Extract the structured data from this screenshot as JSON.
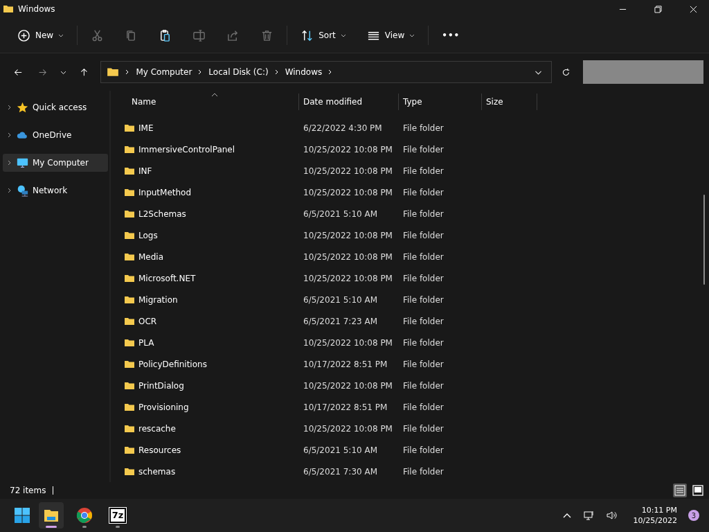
{
  "window": {
    "title": "Windows"
  },
  "toolbar": [
    {
      "kind": "new",
      "label": "New",
      "disabled": false
    },
    {
      "kind": "cut",
      "disabled": true
    },
    {
      "kind": "copy",
      "disabled": true
    },
    {
      "kind": "paste",
      "disabled": false
    },
    {
      "kind": "rename",
      "disabled": true
    },
    {
      "kind": "share",
      "disabled": true
    },
    {
      "kind": "delete",
      "disabled": true
    },
    {
      "kind": "sort",
      "label": "Sort",
      "disabled": false
    },
    {
      "kind": "view",
      "label": "View",
      "disabled": false
    },
    {
      "kind": "more",
      "label": "•••",
      "disabled": false
    }
  ],
  "nav": {
    "forward_disabled": true
  },
  "breadcrumb": [
    "My Computer",
    "Local Disk (C:)",
    "Windows"
  ],
  "sidebar": {
    "items": [
      {
        "label": "Quick access",
        "kind": "star",
        "selected": false
      },
      {
        "label": "OneDrive",
        "kind": "cloud",
        "selected": false
      },
      {
        "label": "My Computer",
        "kind": "pc",
        "selected": true
      },
      {
        "label": "Network",
        "kind": "network",
        "selected": false
      }
    ]
  },
  "table": {
    "columns": [
      "Name",
      "Date modified",
      "Type",
      "Size"
    ],
    "rows": [
      [
        "IME",
        "6/22/2022 4:30 PM",
        "File folder"
      ],
      [
        "ImmersiveControlPanel",
        "10/25/2022 10:08 PM",
        "File folder"
      ],
      [
        "INF",
        "10/25/2022 10:08 PM",
        "File folder"
      ],
      [
        "InputMethod",
        "10/25/2022 10:08 PM",
        "File folder"
      ],
      [
        "L2Schemas",
        "6/5/2021 5:10 AM",
        "File folder"
      ],
      [
        "Logs",
        "10/25/2022 10:08 PM",
        "File folder"
      ],
      [
        "Media",
        "10/25/2022 10:08 PM",
        "File folder"
      ],
      [
        "Microsoft.NET",
        "10/25/2022 10:08 PM",
        "File folder"
      ],
      [
        "Migration",
        "6/5/2021 5:10 AM",
        "File folder"
      ],
      [
        "OCR",
        "6/5/2021 7:23 AM",
        "File folder"
      ],
      [
        "PLA",
        "10/25/2022 10:08 PM",
        "File folder"
      ],
      [
        "PolicyDefinitions",
        "10/17/2022 8:51 PM",
        "File folder"
      ],
      [
        "PrintDialog",
        "10/25/2022 10:08 PM",
        "File folder"
      ],
      [
        "Provisioning",
        "10/17/2022 8:51 PM",
        "File folder"
      ],
      [
        "rescache",
        "10/25/2022 10:08 PM",
        "File folder"
      ],
      [
        "Resources",
        "6/5/2021 5:10 AM",
        "File folder"
      ],
      [
        "schemas",
        "6/5/2021 7:30 AM",
        "File folder"
      ]
    ]
  },
  "status_bar": {
    "count": "72 items",
    "details_view": {
      "selected": true
    },
    "tiles_view": {
      "selected": false
    }
  },
  "taskbar": {
    "apps": [
      {
        "kind": "explorer",
        "active": true
      },
      {
        "kind": "chrome",
        "active": false
      },
      {
        "kind": "sevenzip",
        "label": "7z",
        "active": false
      }
    ],
    "time": "10:11 PM",
    "date": "10/25/2022",
    "notifications": "3"
  }
}
